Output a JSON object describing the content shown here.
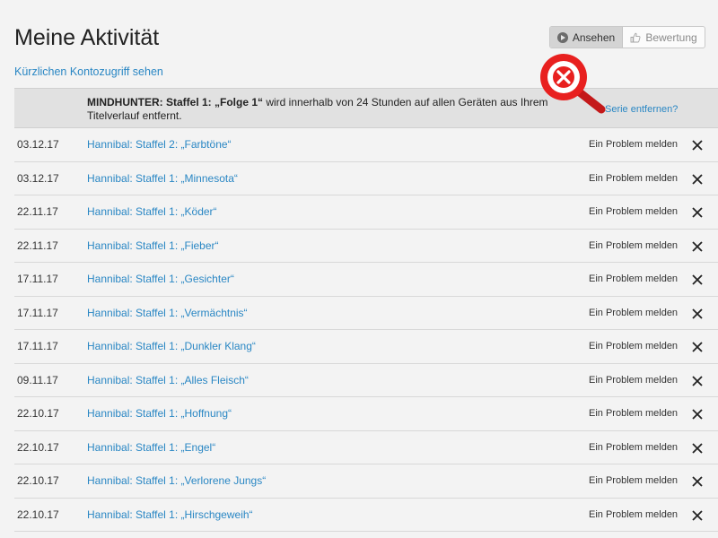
{
  "header": {
    "title": "Meine Aktivität",
    "recent_access_link": "Kürzlichen Kontozugriff sehen"
  },
  "view_toggle": {
    "options": [
      {
        "label": "Ansehen",
        "icon": "play-icon",
        "active": true
      },
      {
        "label": "Bewertung",
        "icon": "thumb-icon",
        "active": false
      }
    ]
  },
  "notice": {
    "show_title": "MINDHUNTER: Staffel 1: „Folge 1“",
    "message": " wird innerhalb von 24 Stunden auf allen Geräten aus Ihrem Titelverlauf entfernt.",
    "remove_series_link": "Serie entfernen?"
  },
  "history": {
    "report_label": "Ein Problem melden",
    "rows": [
      {
        "date": "03.12.17",
        "title": "Hannibal: Staffel 2: „Farbtöne“"
      },
      {
        "date": "03.12.17",
        "title": "Hannibal: Staffel 1: „Minnesota“"
      },
      {
        "date": "22.11.17",
        "title": "Hannibal: Staffel 1: „Köder“"
      },
      {
        "date": "22.11.17",
        "title": "Hannibal: Staffel 1: „Fieber“"
      },
      {
        "date": "17.11.17",
        "title": "Hannibal: Staffel 1: „Gesichter“"
      },
      {
        "date": "17.11.17",
        "title": "Hannibal: Staffel 1: „Vermächtnis“"
      },
      {
        "date": "17.11.17",
        "title": "Hannibal: Staffel 1: „Dunkler Klang“"
      },
      {
        "date": "09.11.17",
        "title": "Hannibal: Staffel 1: „Alles Fleisch“"
      },
      {
        "date": "22.10.17",
        "title": "Hannibal: Staffel 1: „Hoffnung“"
      },
      {
        "date": "22.10.17",
        "title": "Hannibal: Staffel 1: „Engel“"
      },
      {
        "date": "22.10.17",
        "title": "Hannibal: Staffel 1: „Verlorene Jungs“"
      },
      {
        "date": "22.10.17",
        "title": "Hannibal: Staffel 1: „Hirschgeweih“"
      }
    ]
  },
  "colors": {
    "link": "#2a87c4",
    "background": "#f3f3f3",
    "notice_background": "#e1e1e1",
    "magnifier_red": "#e8201f"
  }
}
